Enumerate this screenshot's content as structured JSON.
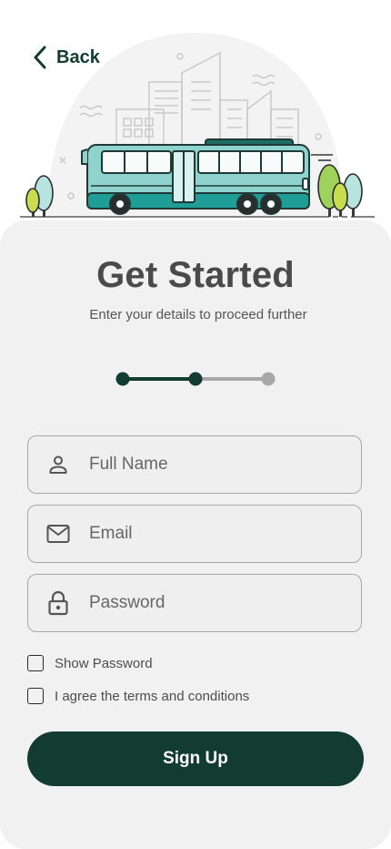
{
  "header": {
    "back_label": "Back"
  },
  "form": {
    "title": "Get Started",
    "subtitle": "Enter your details to proceed further",
    "progress": {
      "current_step": 2,
      "total_steps": 3
    },
    "fields": {
      "full_name": {
        "placeholder": "Full Name",
        "value": "",
        "icon": "person-icon"
      },
      "email": {
        "placeholder": "Email",
        "value": "",
        "icon": "mail-icon"
      },
      "password": {
        "placeholder": "Password",
        "value": "",
        "icon": "lock-icon"
      }
    },
    "show_password_label": "Show Password",
    "terms_label": "I agree the terms and conditions",
    "submit_label": "Sign Up"
  },
  "colors": {
    "primary": "#123c30",
    "card_background": "#f1f1f1",
    "step_inactive": "#a8a8a8",
    "bus_teal": "#8fd3cf"
  }
}
